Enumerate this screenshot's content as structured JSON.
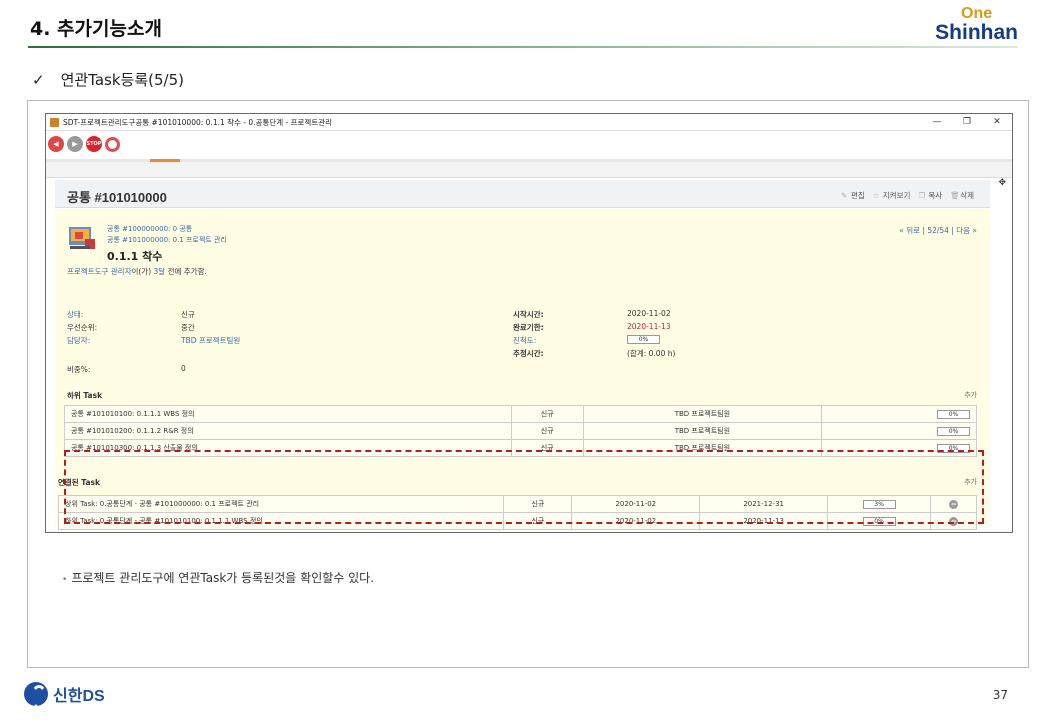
{
  "slide": {
    "title": "4. 추가기능소개",
    "brand_top": "One",
    "brand_bottom": "Shinhan",
    "subtitle_check": "✓",
    "subtitle": "연관Task등록(5/5)",
    "note": "프로젝트 관리도구에 연관Task가 등록된것을 확인할수 있다.",
    "footer_brand": "신한DS",
    "page_number": "37"
  },
  "window": {
    "title": "SDT-프로젝트관리도구공통 #101010000: 0.1.1 착수 - 0.공통단계 - 프로젝트관리",
    "minimize": "—",
    "maximize": "❐",
    "close": "✕"
  },
  "toolbar": {
    "back": "◀",
    "forward": "▶",
    "stop": "STOP",
    "refresh": ""
  },
  "issue": {
    "header_title": "공통 #101010000",
    "actions": {
      "edit": "편집",
      "watch": "지켜보기",
      "copy": "복사",
      "delete": "삭제"
    },
    "side_plus": "✥",
    "parent_1": "공통 #100000000: 0 공통",
    "parent_2": "공통 #101000000: 0.1 프로젝트 관리",
    "subject": "0.1.1 착수",
    "nav": "« 뒤로 |  52/54 |  다음 »",
    "author_link": "프로젝트도구 관리자",
    "author_mid": "이(가) ",
    "author_time": "3달",
    "author_tail": " 전에 추가함.",
    "status_label": "상태:",
    "status_value": "신규",
    "priority_label": "우선순위:",
    "priority_value": "중간",
    "assignee_label": "담당자:",
    "assignee_value": "TBD 프로젝트팀원",
    "weight_label": "비중%:",
    "weight_value": "0",
    "start_label": "시작시간:",
    "start_value": "2020-11-02",
    "due_label": "완료기한:",
    "due_value": "2020-11-13",
    "progress_label": "진척도:",
    "progress_value": "0%",
    "estimate_label": "추정시간:",
    "estimate_value": "(합계: 0.00 h)"
  },
  "subtasks": {
    "label": "하위 Task",
    "add": "추가",
    "rows": [
      {
        "id": "공통 #101010100:",
        "title": "0.1.1.1 WBS 정의",
        "status": "신규",
        "assignee": "TBD 프로젝트팀원",
        "progress": "0%"
      },
      {
        "id": "공통 #101010200:",
        "title": "0.1.1.2 R&R 정의",
        "status": "신규",
        "assignee": "TBD 프로젝트팀원",
        "progress": "0%"
      },
      {
        "id": "공통 #101010300:",
        "title": "0.1.1.3 산출물 정의",
        "status": "신규",
        "assignee": "TBD 프로젝트팀원",
        "progress": "0%"
      }
    ]
  },
  "related": {
    "label": "연결된 Task",
    "add": "추가",
    "rows": [
      {
        "text": "상위 Task: 0.공통단계 - 공통 #101000000: 0.1 프로젝트 관리",
        "status": "신규",
        "start": "2020-11-02",
        "end": "2021-12-31",
        "progress": "3%",
        "progress_value": 3
      },
      {
        "text": "하위 Task: 0.공통단계 - 공통 #101010100: 0.1.1.1 WBS 정의",
        "status": "신규",
        "start": "2020-11-02",
        "end": "2020-11-13",
        "progress": "0%",
        "progress_value": 0
      }
    ]
  },
  "colors": {
    "accent_green": "#2a6f3a",
    "brand_blue": "#163a8a",
    "brand_gold": "#d39c1e",
    "highlight_red": "#b71c1c",
    "issue_bg": "#fffee4"
  }
}
